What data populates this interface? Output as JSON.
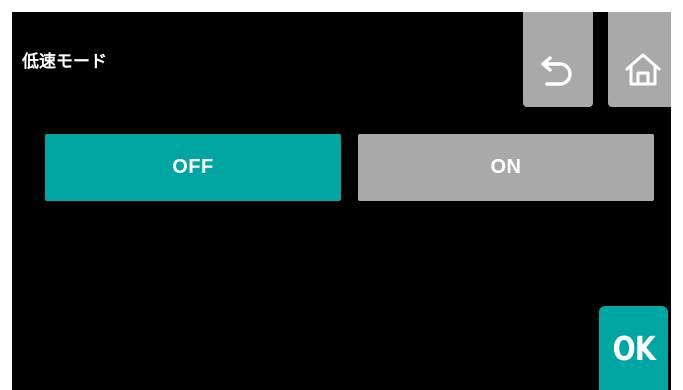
{
  "screen": {
    "title": "低速モード"
  },
  "navigation": {
    "back_icon": "undo-arrow-icon",
    "home_icon": "home-icon"
  },
  "mode_options": [
    {
      "label": "OFF",
      "selected": true
    },
    {
      "label": "ON",
      "selected": false
    }
  ],
  "confirm": {
    "label": "OK"
  },
  "colors": {
    "background": "#000000",
    "selected": "#00a6a1",
    "unselected": "#a9a9a9",
    "ok": "#00a6a1",
    "icon_button": "#a9a9a9",
    "text": "#ffffff"
  }
}
